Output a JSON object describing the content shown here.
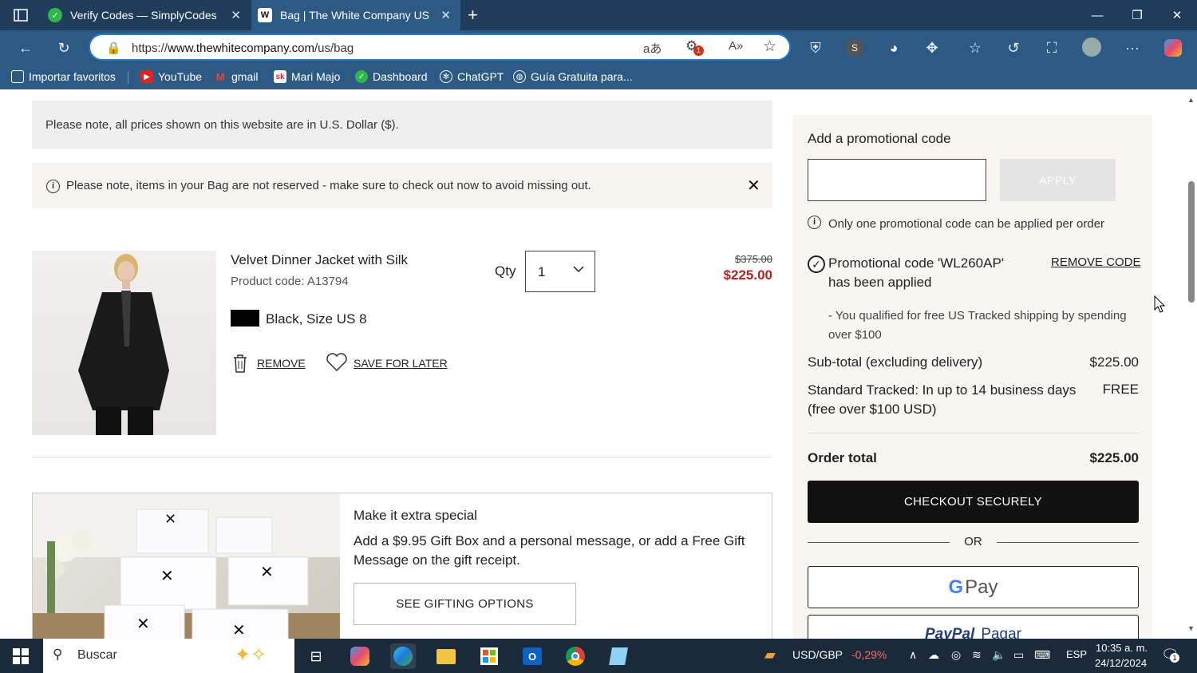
{
  "browser": {
    "tabs": [
      {
        "title": "Verify Codes — SimplyCodes",
        "icon": "simplycodes-icon",
        "color": "#2bb94a"
      },
      {
        "title": "Bag | The White Company US",
        "icon": "whitecompany-icon",
        "color": "#ffffff"
      }
    ],
    "url_prefix": "https://",
    "url_domain": "www.thewhitecompany.com",
    "url_path": "/us/bag",
    "badge_count": "1",
    "bookmarks": [
      {
        "label": "Importar favoritos",
        "icon": "import-icon"
      },
      {
        "label": "YouTube",
        "icon": "youtube-icon",
        "color": "#e62117"
      },
      {
        "label": "gmail",
        "icon": "gmail-icon"
      },
      {
        "label": "Mari Majo",
        "icon": "sk-icon",
        "color": "#e3194b"
      },
      {
        "label": "Dashboard",
        "icon": "dashboard-icon",
        "color": "#2bb94a"
      },
      {
        "label": "ChatGPT",
        "icon": "chatgpt-icon"
      },
      {
        "label": "Guía Gratuita para...",
        "icon": "globe-icon"
      }
    ]
  },
  "notices": {
    "currency": "Please note, all prices shown on this website are in U.S. Dollar ($).",
    "reserve": "Please note, items in your Bag are not reserved - make sure to check out now to avoid missing out."
  },
  "product": {
    "name": "Velvet Dinner Jacket with Silk",
    "code": "Product code: A13794",
    "variant": "Black, Size US 8",
    "swatch_color": "#000000",
    "qty_label": "Qty",
    "qty_value": "1",
    "old_price": "$375.00",
    "new_price": "$225.00",
    "remove_label": "REMOVE",
    "save_label": "SAVE FOR LATER"
  },
  "gift": {
    "title": "Make it extra special",
    "text": "Add a $9.95 Gift Box and a personal message, or add a Free Gift Message on the gift receipt.",
    "button": "SEE GIFTING OPTIONS"
  },
  "summary": {
    "promo_title": "Add a promotional code",
    "apply_label": "APPLY",
    "one_code_note": "Only one promotional code can be applied per order",
    "promo_applied_line1": "Promotional code 'WL260AP'",
    "promo_applied_line2": "has been applied",
    "remove_code": "REMOVE CODE",
    "qualified": "- You qualified for free US Tracked shipping by spending over $100",
    "subtotal_label": "Sub-total (excluding delivery)",
    "subtotal_value": "$225.00",
    "shipping_label_1": "Standard Tracked: In up to 14 business days",
    "shipping_label_2": "(free over $100 USD)",
    "shipping_value": "FREE",
    "total_label": "Order total",
    "total_value": "$225.00",
    "checkout": "CHECKOUT SECURELY",
    "or": "OR",
    "gpay": "Pay",
    "paypal_brand": "PayPal",
    "paypal_action": "Pagar",
    "brand_color": "#111111",
    "price_color": "#b52222"
  },
  "taskbar": {
    "search": "Buscar",
    "ticker": "USD/GBP",
    "ticker_change": "-0,29%",
    "lang": "ESP",
    "time": "10:35 a. m.",
    "date": "24/12/2024",
    "notif_count": "1"
  }
}
